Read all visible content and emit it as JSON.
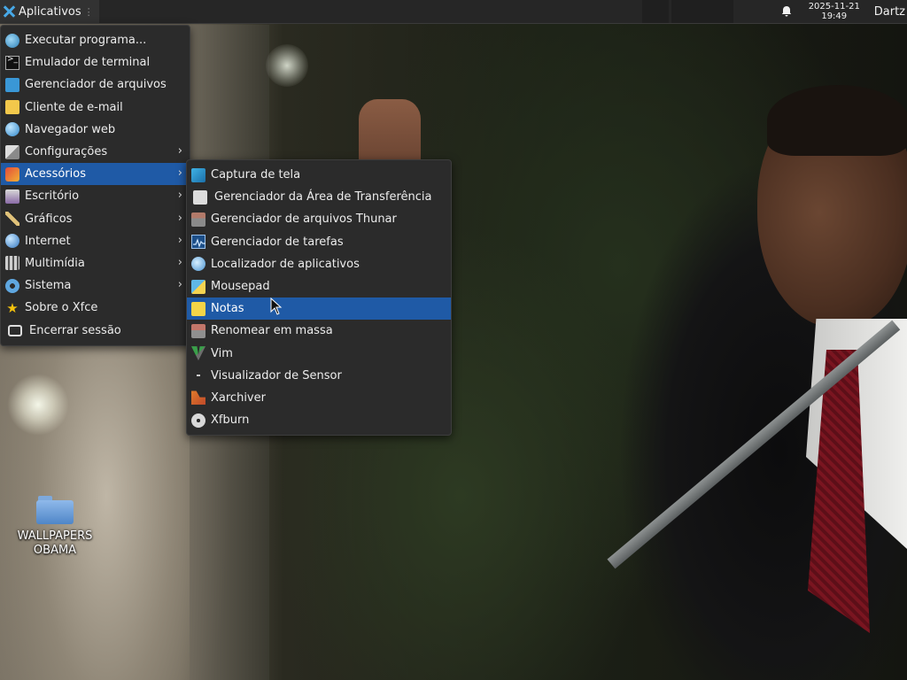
{
  "panel": {
    "apps_label": "Aplicativos",
    "clock_date": "2025-11-21",
    "clock_time": "19:49",
    "user": "Dartz"
  },
  "main_menu": {
    "items": [
      {
        "label": "Executar programa...",
        "icon": "run-icon",
        "submenu": false
      },
      {
        "label": "Emulador de terminal",
        "icon": "terminal-icon",
        "submenu": false
      },
      {
        "label": "Gerenciador de arquivos",
        "icon": "file-manager-icon",
        "submenu": false
      },
      {
        "label": "Cliente de e-mail",
        "icon": "mail-icon",
        "submenu": false
      },
      {
        "label": "Navegador web",
        "icon": "web-browser-icon",
        "submenu": false
      },
      {
        "label": "Configurações",
        "icon": "settings-icon",
        "submenu": true
      },
      {
        "label": "Acessórios",
        "icon": "accessories-icon",
        "submenu": true,
        "active": true
      },
      {
        "label": "Escritório",
        "icon": "office-icon",
        "submenu": true
      },
      {
        "label": "Gráficos",
        "icon": "graphics-icon",
        "submenu": true
      },
      {
        "label": "Internet",
        "icon": "internet-icon",
        "submenu": true
      },
      {
        "label": "Multimídia",
        "icon": "multimedia-icon",
        "submenu": true
      },
      {
        "label": "Sistema",
        "icon": "system-icon",
        "submenu": true
      },
      {
        "label": "Sobre o Xfce",
        "icon": "star-icon",
        "submenu": false
      },
      {
        "label": "Encerrar sessão",
        "icon": "logout-icon",
        "submenu": false
      }
    ]
  },
  "sub_menu": {
    "items": [
      {
        "label": "Captura de tela",
        "icon": "screenshot-icon"
      },
      {
        "label": "Gerenciador da Área de Transferência",
        "icon": "clipboard-icon"
      },
      {
        "label": "Gerenciador de arquivos Thunar",
        "icon": "thunar-icon"
      },
      {
        "label": "Gerenciador de tarefas",
        "icon": "task-manager-icon"
      },
      {
        "label": "Localizador de aplicativos",
        "icon": "app-finder-icon"
      },
      {
        "label": "Mousepad",
        "icon": "mousepad-icon"
      },
      {
        "label": "Notas",
        "icon": "notes-icon",
        "active": true
      },
      {
        "label": "Renomear em massa",
        "icon": "bulk-rename-icon"
      },
      {
        "label": "Vim",
        "icon": "vim-icon"
      },
      {
        "label": "Visualizador de Sensor",
        "icon": "sensor-icon"
      },
      {
        "label": "Xarchiver",
        "icon": "xarchiver-icon"
      },
      {
        "label": "Xfburn",
        "icon": "xfburn-icon"
      }
    ]
  },
  "desktop": {
    "icon_label_line1": "WALLPAPERS",
    "icon_label_line2": "OBAMA"
  },
  "colors": {
    "highlight": "#1f5aa6",
    "menu_bg": "#2b2b2b",
    "panel_bg": "#262626"
  }
}
